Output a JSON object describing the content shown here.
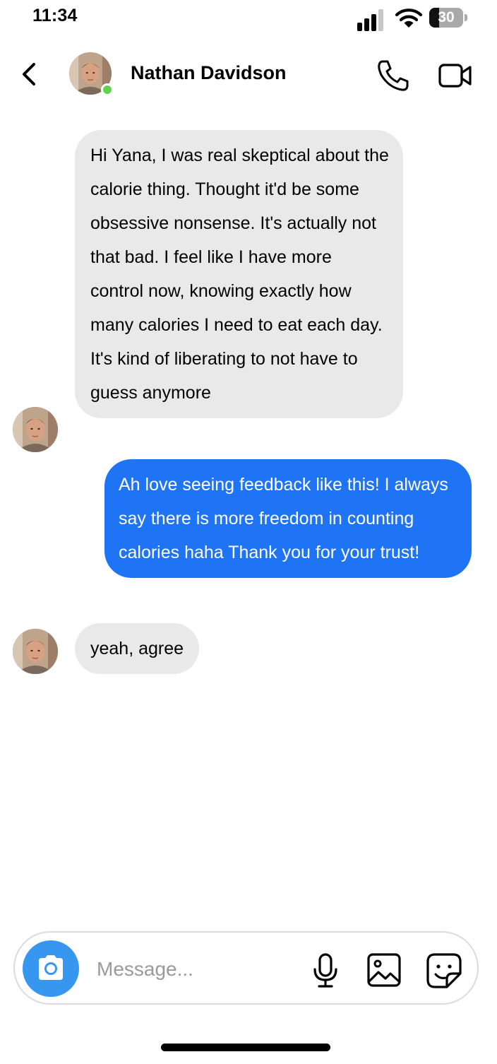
{
  "status_bar": {
    "time": "11:34",
    "battery_level": "30",
    "battery_fraction": 0.3
  },
  "header": {
    "contact_name": "Nathan Davidson",
    "online": true,
    "online_color": "#5fd34a",
    "icons": [
      "chevron-left-icon",
      "avatar",
      "phone-icon",
      "video-camera-icon"
    ]
  },
  "messages": [
    {
      "direction": "incoming",
      "text": "Hi Yana, I was real skeptical about the calorie thing. Thought it'd be some obsessive nonsense. It's actually not that bad. I feel like I have more control now, knowing exactly how many calories I need to eat each day. It's kind of liberating to not have to guess anymore"
    },
    {
      "direction": "outgoing",
      "text": "Ah love seeing feedback like this! I always say there is more freedom in counting calories haha Thank you for your trust!"
    },
    {
      "direction": "incoming",
      "text": "yeah, agree"
    }
  ],
  "composer": {
    "placeholder": "Message...",
    "value": "",
    "icons": [
      "camera-icon",
      "microphone-icon",
      "image-icon",
      "sticker-icon"
    ]
  },
  "colors": {
    "incoming_bubble": "#e9e9ea",
    "outgoing_bubble": "#1f74f5",
    "camera_button": "#3797f0"
  }
}
